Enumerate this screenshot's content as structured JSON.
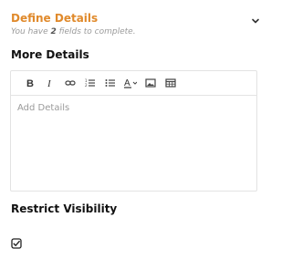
{
  "section": {
    "title": "Define Details",
    "subtitle_prefix": "You have ",
    "subtitle_count": "2",
    "subtitle_suffix": " fields to complete."
  },
  "more_details": {
    "label": "More Details",
    "placeholder": "Add Details",
    "toolbar": [
      {
        "icon": "bold-icon"
      },
      {
        "icon": "italic-icon"
      },
      {
        "icon": "link-icon"
      },
      {
        "icon": "ordered-list-icon"
      },
      {
        "icon": "bullet-list-icon"
      },
      {
        "icon": "text-color-icon"
      },
      {
        "icon": "image-icon"
      },
      {
        "icon": "table-icon"
      }
    ]
  },
  "restrict_visibility": {
    "label": "Restrict Visibility",
    "checked": true
  },
  "colors": {
    "accent": "#e08a2c",
    "muted": "#9a9a9a",
    "border": "#e3e3e3"
  }
}
